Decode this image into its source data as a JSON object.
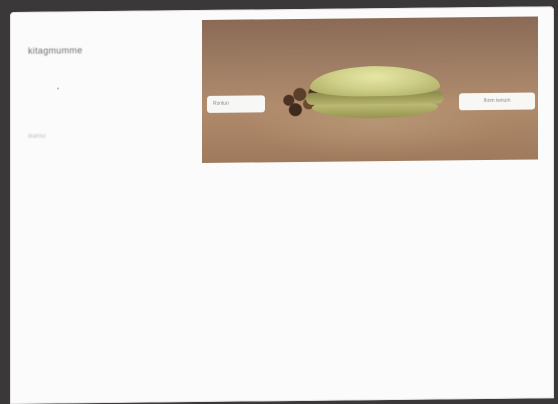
{
  "screen": {
    "title": "kitagmumme",
    "small_label": "Ikansu"
  },
  "hero": {
    "image": "sandwich-photo",
    "left_button_label": "Rsntun",
    "right_button_label": "Ihnm iwnum"
  }
}
